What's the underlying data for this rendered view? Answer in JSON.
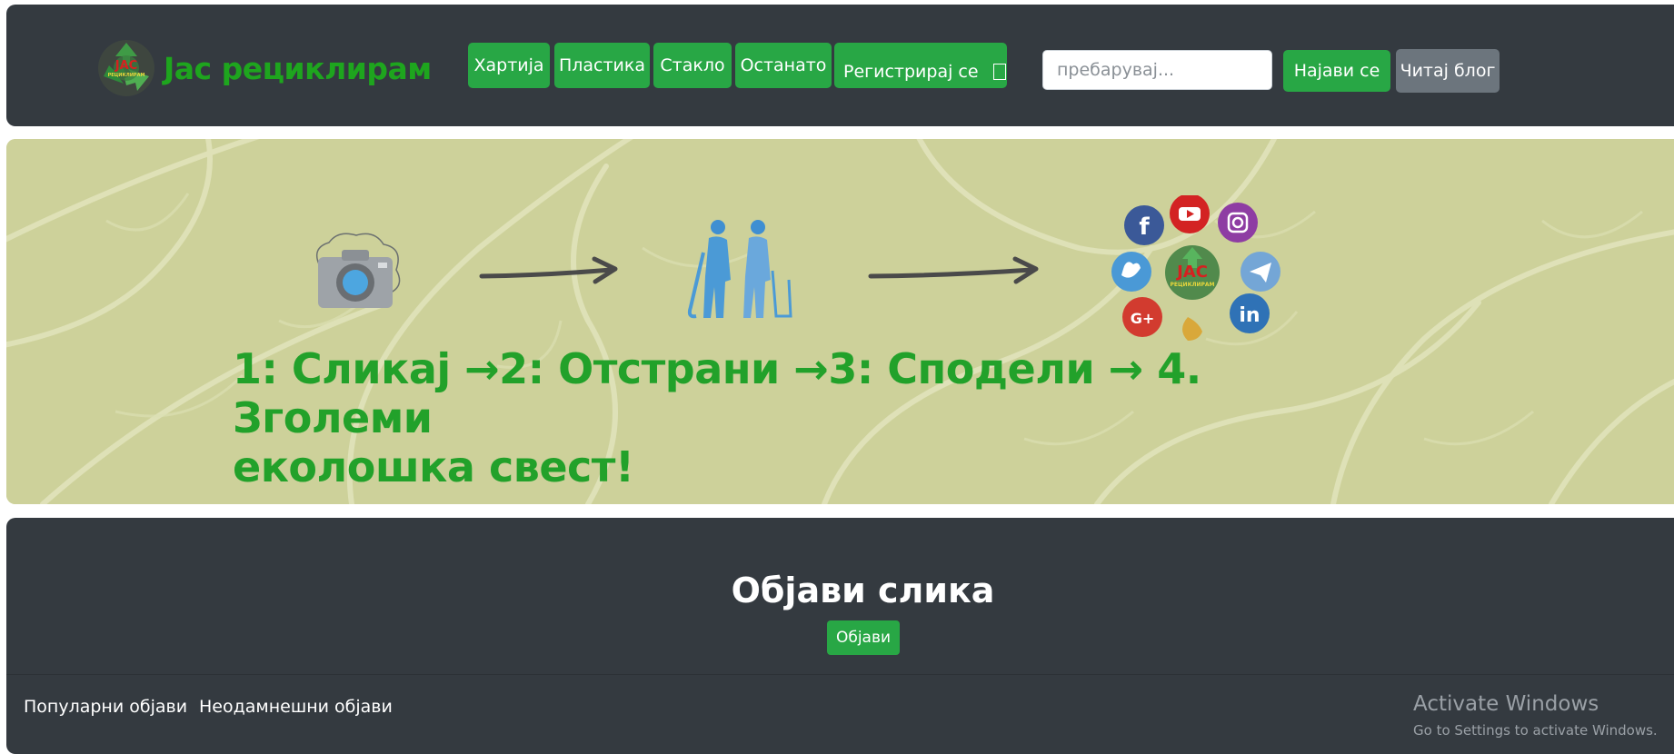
{
  "brand": {
    "name": "Јас рециклирам",
    "logo_text": "ЈАС",
    "logo_subtext": "РЕЦИКЛИРАМ"
  },
  "nav": {
    "items": [
      {
        "label": "Хартија"
      },
      {
        "label": "Пластика"
      },
      {
        "label": "Стакло"
      },
      {
        "label": "Останато"
      }
    ],
    "register_label": "Регистрирај се",
    "search_placeholder": "пребарувај...",
    "login_label": "Најави се",
    "blog_label": "Читај блог"
  },
  "banner": {
    "tagline_line1": "1: Сликај →2: Отстрани →3: Сподели → 4. Зголеми",
    "tagline_line2": "еколошка свест!",
    "center_logo_text": "ЈАС",
    "center_logo_subtext": "РЕЦИКЛИРАМ",
    "icons": [
      "camera-icon",
      "arrow-icon",
      "people-cleaning-icon",
      "arrow-icon",
      "social-media-cluster-icon"
    ]
  },
  "post_section": {
    "title": "Објави слика",
    "post_button": "Објави",
    "tabs": [
      {
        "label": "Популарни објави"
      },
      {
        "label": "Неодамнешни објави"
      }
    ]
  },
  "watermark": {
    "title": "Activate Windows",
    "subtitle": "Go to Settings to activate Windows."
  },
  "colors": {
    "navbar_bg": "#343a40",
    "accent_green": "#28a745",
    "brand_green": "#1ea51e",
    "banner_bg": "#cdd19a",
    "secondary_btn": "#6c757d"
  }
}
